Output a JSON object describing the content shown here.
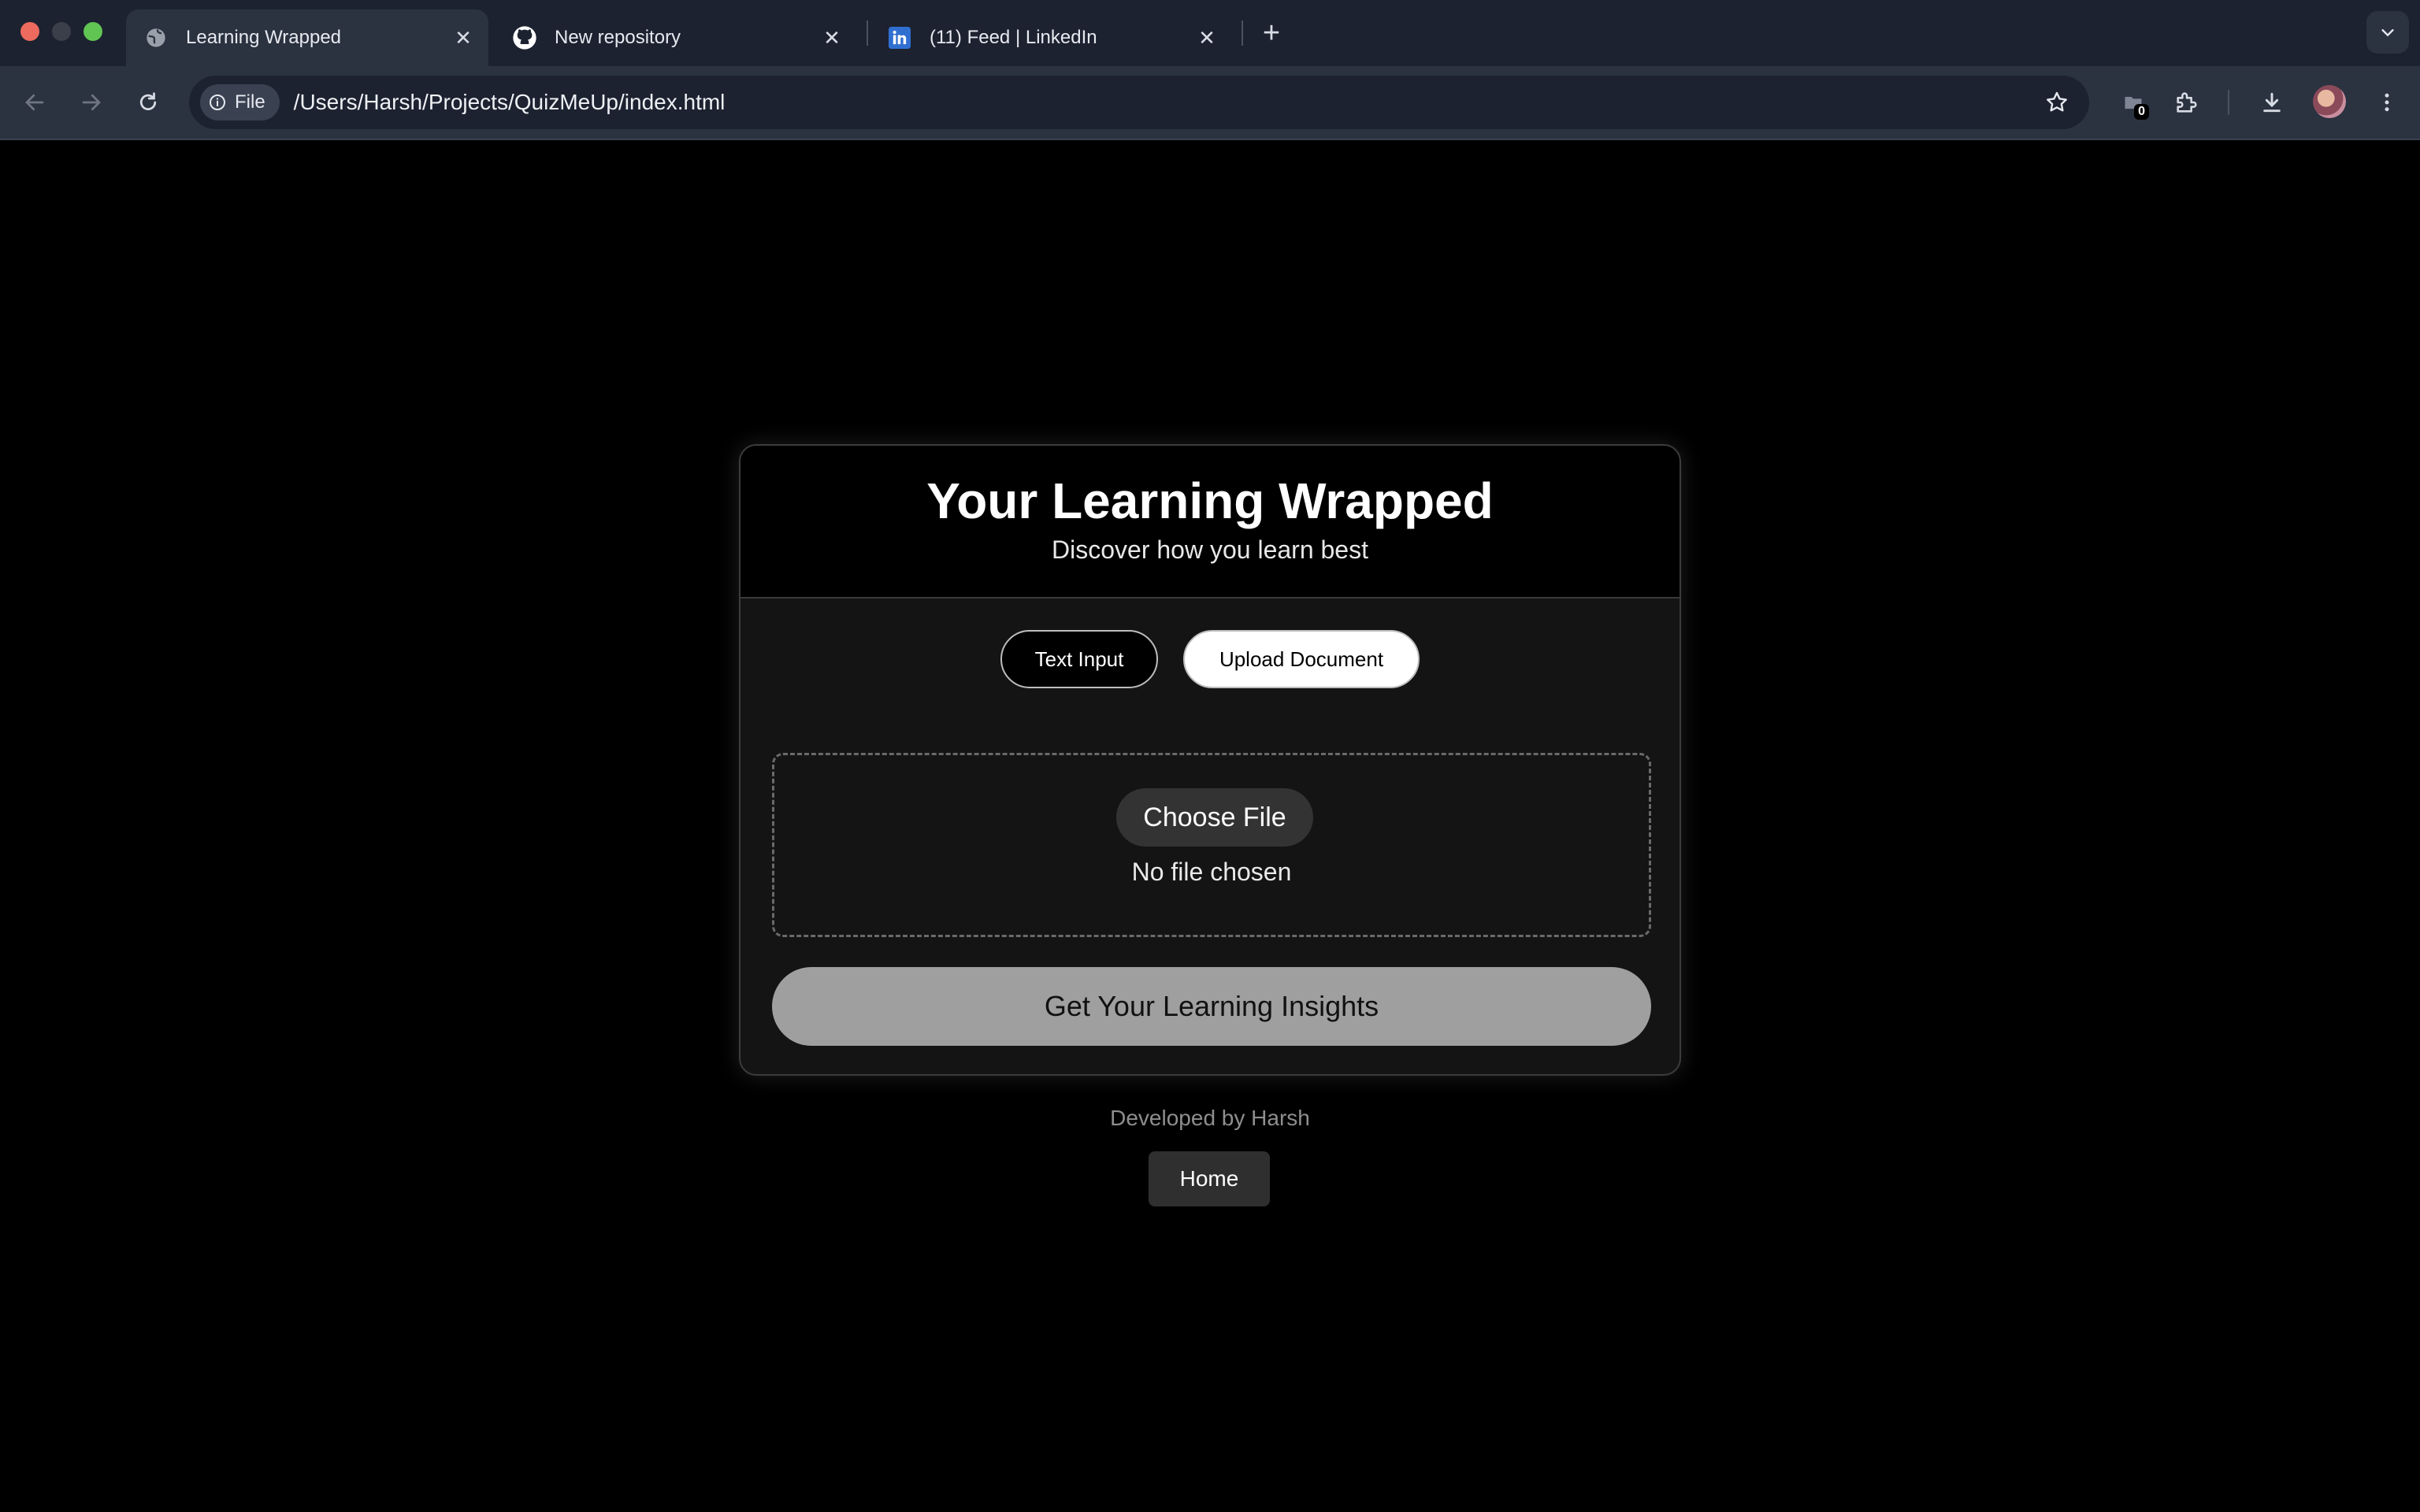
{
  "browser": {
    "tabs": [
      {
        "title": "Learning Wrapped",
        "favicon": "globe-icon",
        "active": true
      },
      {
        "title": "New repository",
        "favicon": "github-icon",
        "active": false
      },
      {
        "title": "(11) Feed | LinkedIn",
        "favicon": "linkedin-icon",
        "active": false
      }
    ],
    "omnibox": {
      "scheme_chip": "File",
      "url": "/Users/Harsh/Projects/QuizMeUp/index.html"
    },
    "extension_badge": "0"
  },
  "page": {
    "title": "Your Learning Wrapped",
    "subtitle": "Discover how you learn best",
    "modes": {
      "text_input": "Text Input",
      "upload_document": "Upload Document",
      "selected": "upload_document"
    },
    "upload": {
      "choose_label": "Choose File",
      "status": "No file chosen"
    },
    "submit_label": "Get Your Learning Insights",
    "footer": {
      "credit": "Developed by Harsh",
      "home_label": "Home"
    }
  }
}
